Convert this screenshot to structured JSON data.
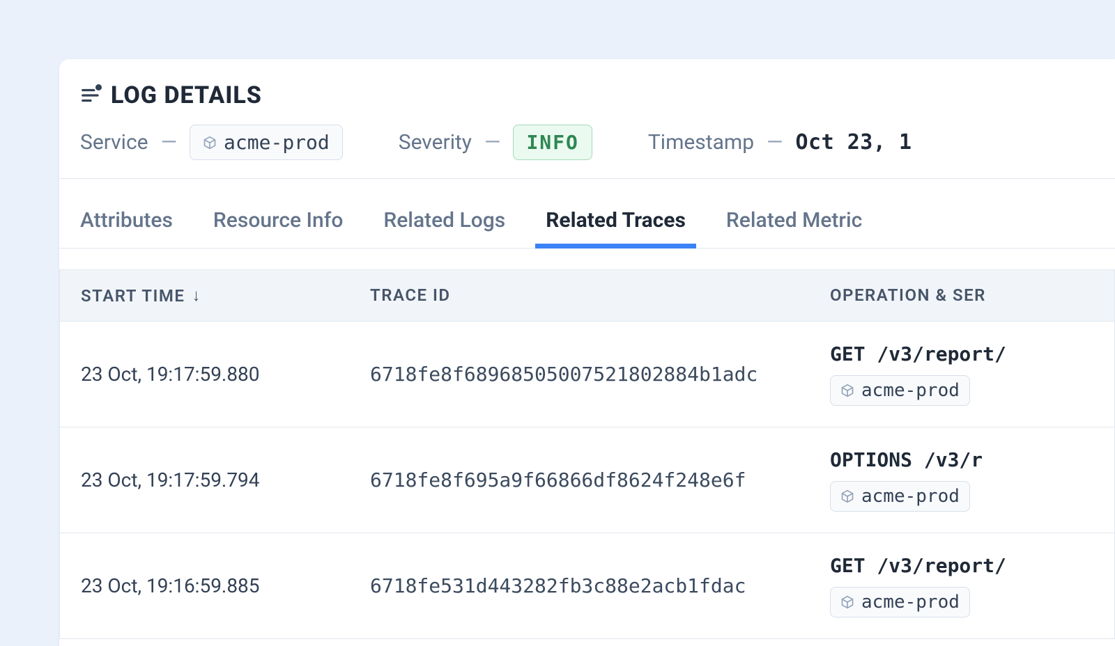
{
  "header": {
    "title": "LOG DETAILS",
    "service": {
      "label": "Service",
      "value": "acme-prod"
    },
    "severity": {
      "label": "Severity",
      "value": "INFO"
    },
    "timestamp": {
      "label": "Timestamp",
      "value": "Oct 23, 1"
    }
  },
  "tabs": [
    {
      "label": "Attributes",
      "active": false
    },
    {
      "label": "Resource Info",
      "active": false
    },
    {
      "label": "Related Logs",
      "active": false
    },
    {
      "label": "Related Traces",
      "active": true
    },
    {
      "label": "Related Metric",
      "active": false
    }
  ],
  "table": {
    "columns": {
      "start_time": "START TIME",
      "trace_id": "TRACE ID",
      "operation": "OPERATION & SER"
    },
    "rows": [
      {
        "start": "23 Oct, 19:17:59.880",
        "trace": "6718fe8f68968505007521802884b1adc",
        "op": "GET /v3/report/",
        "svc": "acme-prod"
      },
      {
        "start": "23 Oct, 19:17:59.794",
        "trace": "6718fe8f695a9f66866df8624f248e6f",
        "op": "OPTIONS /v3/r",
        "svc": "acme-prod"
      },
      {
        "start": "23 Oct, 19:16:59.885",
        "trace": "6718fe531d443282fb3c88e2acb1fdac",
        "op": "GET /v3/report/",
        "svc": "acme-prod"
      }
    ]
  }
}
